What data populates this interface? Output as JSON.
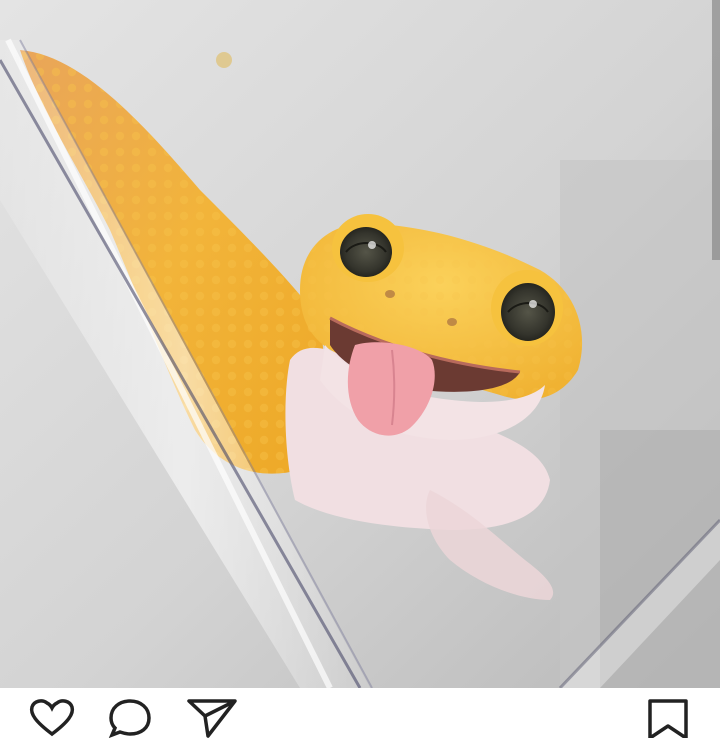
{
  "post": {
    "photo": {
      "icon": "leopard-gecko-photo"
    }
  },
  "action_bar": {
    "icons": [
      "heart-icon",
      "comment-icon",
      "share-icon",
      "bookmark-icon"
    ]
  },
  "colors": {
    "gecko_orange": "#f0b030",
    "gecko_belly": "#f1dfe2",
    "tongue": "#f0a0a8",
    "background": "#cfcfcf",
    "icon_stroke": "#222222"
  }
}
